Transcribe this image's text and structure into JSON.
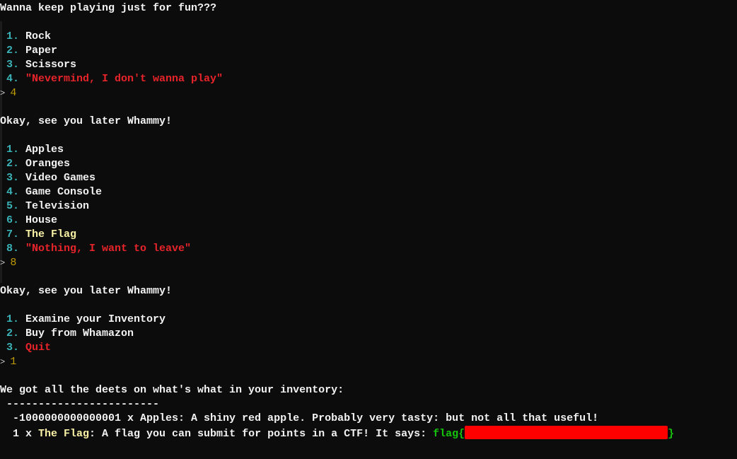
{
  "colors": {
    "cyan": "#3ab3b8",
    "red": "#e7242a",
    "yellow": "#f9f1a5",
    "green": "#16c60c",
    "gold": "#c19c00",
    "background": "#0c0c0c"
  },
  "lines": [
    [
      {
        "t": "Wanna keep playing just for fun???",
        "c": "white"
      }
    ],
    [],
    [
      {
        "t": " 1. ",
        "c": "cyan"
      },
      {
        "t": "Rock",
        "c": "white"
      }
    ],
    [
      {
        "t": " 2. ",
        "c": "cyan"
      },
      {
        "t": "Paper",
        "c": "white"
      }
    ],
    [
      {
        "t": " 3. ",
        "c": "cyan"
      },
      {
        "t": "Scissors",
        "c": "white"
      }
    ],
    [
      {
        "t": " 4. ",
        "c": "cyan"
      },
      {
        "t": "\"Nevermind, I don't wanna play\"",
        "c": "red"
      }
    ],
    [
      {
        "t": "> ",
        "c": "prompt"
      },
      {
        "t": "4",
        "c": "gold"
      }
    ],
    [],
    [
      {
        "t": "Okay, see you later Whammy!",
        "c": "white"
      }
    ],
    [],
    [
      {
        "t": " 1. ",
        "c": "cyan"
      },
      {
        "t": "Apples",
        "c": "white"
      }
    ],
    [
      {
        "t": " 2. ",
        "c": "cyan"
      },
      {
        "t": "Oranges",
        "c": "white"
      }
    ],
    [
      {
        "t": " 3. ",
        "c": "cyan"
      },
      {
        "t": "Video Games",
        "c": "white"
      }
    ],
    [
      {
        "t": " 4. ",
        "c": "cyan"
      },
      {
        "t": "Game Console",
        "c": "white"
      }
    ],
    [
      {
        "t": " 5. ",
        "c": "cyan"
      },
      {
        "t": "Television",
        "c": "white"
      }
    ],
    [
      {
        "t": " 6. ",
        "c": "cyan"
      },
      {
        "t": "House",
        "c": "white"
      }
    ],
    [
      {
        "t": " 7. ",
        "c": "cyan"
      },
      {
        "t": "The Flag",
        "c": "yellow"
      }
    ],
    [
      {
        "t": " 8. ",
        "c": "cyan"
      },
      {
        "t": "\"Nothing, I want to leave\"",
        "c": "red"
      }
    ],
    [
      {
        "t": "> ",
        "c": "prompt"
      },
      {
        "t": "8",
        "c": "gold"
      }
    ],
    [],
    [
      {
        "t": "Okay, see you later Whammy!",
        "c": "white"
      }
    ],
    [],
    [
      {
        "t": " 1. ",
        "c": "cyan"
      },
      {
        "t": "Examine your Inventory",
        "c": "white"
      }
    ],
    [
      {
        "t": " 2. ",
        "c": "cyan"
      },
      {
        "t": "Buy from Whamazon",
        "c": "white"
      }
    ],
    [
      {
        "t": " 3. ",
        "c": "cyan"
      },
      {
        "t": "Quit",
        "c": "red"
      }
    ],
    [
      {
        "t": "> ",
        "c": "prompt"
      },
      {
        "t": "1",
        "c": "gold"
      }
    ],
    [],
    [
      {
        "t": "We got all the deets on what's what in your inventory:",
        "c": "white"
      }
    ],
    [
      {
        "t": " ------------------------",
        "c": "white"
      }
    ],
    [
      {
        "t": "  -1000000000000001 x Apples: A shiny red apple. Probably very tasty: but not all that useful!",
        "c": "white"
      }
    ],
    [
      {
        "t": "  1 x ",
        "c": "white"
      },
      {
        "t": "The Flag",
        "c": "yellow"
      },
      {
        "t": ": A flag you can submit for points in a CTF! It says: ",
        "c": "white"
      },
      {
        "t": "flag{",
        "c": "green"
      },
      {
        "t": "",
        "c": "redact"
      },
      {
        "t": "}",
        "c": "green"
      }
    ]
  ]
}
